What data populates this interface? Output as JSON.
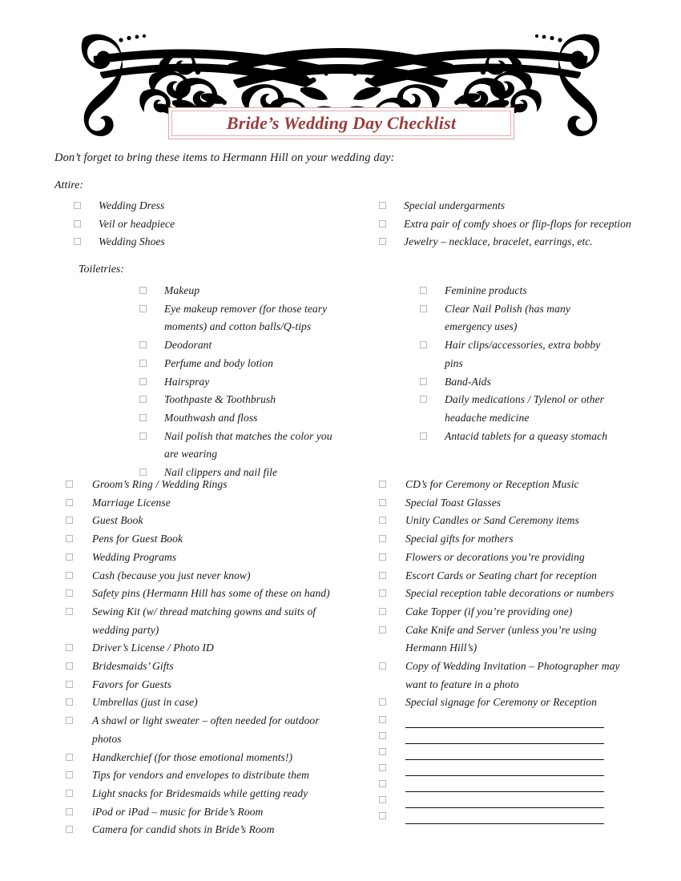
{
  "document": {
    "title": "Bride’s Wedding Day Checklist",
    "intro": "Don’t forget to bring these items to Hermann Hill on your wedding day:",
    "accent_color": "#9e3a3a",
    "border_color": "#dfa6a6",
    "checkbox_color": "#b8b8b8"
  },
  "sections": {
    "attire": {
      "heading": "Attire:",
      "left_items": [
        "Wedding Dress",
        "Veil or headpiece",
        "Wedding Shoes"
      ],
      "right_items": [
        "Special undergarments",
        "Extra pair of comfy shoes or flip-flops for reception",
        "Jewelry – necklace, bracelet, earrings, etc."
      ]
    },
    "toiletries": {
      "heading": "Toiletries:",
      "left_items": [
        "Makeup",
        "Eye makeup remover (for those teary moments) and cotton balls/Q-tips",
        "Deodorant",
        "Perfume and body lotion",
        "Hairspray",
        "Toothpaste & Toothbrush",
        "Mouthwash and floss",
        "Nail polish that matches the color you are wearing",
        "Nail clippers and nail file"
      ],
      "right_items": [
        "Feminine products",
        "Clear Nail Polish (has many emergency uses)",
        "Hair clips/accessories, extra bobby pins",
        "Band-Aids",
        "Daily medications / Tylenol or other headache medicine",
        "Antacid tablets for a queasy stomach"
      ]
    },
    "general": {
      "left_items": [
        "Groom’s Ring / Wedding Rings",
        "Marriage License",
        "Guest Book",
        "Pens for Guest Book",
        "Wedding Programs",
        "Cash (because you just never know)",
        "Safety pins (Hermann Hill has some of these on hand)",
        "Sewing Kit (w/ thread matching gowns and suits of wedding party)",
        "Driver’s License / Photo ID",
        "Bridesmaids’ Gifts",
        "Favors for Guests",
        "Umbrellas (just in case)",
        "A shawl or light sweater – often needed for outdoor photos",
        "Handkerchief (for those emotional moments!)",
        "Tips for vendors and envelopes to distribute them",
        "Light snacks for Bridesmaids while getting ready",
        "iPod or iPad – music for Bride’s Room",
        "Camera for candid shots in Bride’s Room"
      ],
      "right_items": [
        "CD’s for Ceremony or Reception Music",
        "Special Toast Glasses",
        "Unity Candles or Sand Ceremony items",
        "Special gifts for mothers",
        "Flowers or decorations you’re providing",
        "Escort Cards or Seating chart for reception",
        "Special reception table decorations or numbers",
        "Cake Topper (if you’re providing one)",
        "Cake Knife and Server (unless you’re using Hermann Hill’s)",
        "Copy of Wedding Invitation – Photographer may want to feature in a photo",
        "Special signage for Ceremony or Reception"
      ],
      "blank_line_count": 7
    }
  }
}
